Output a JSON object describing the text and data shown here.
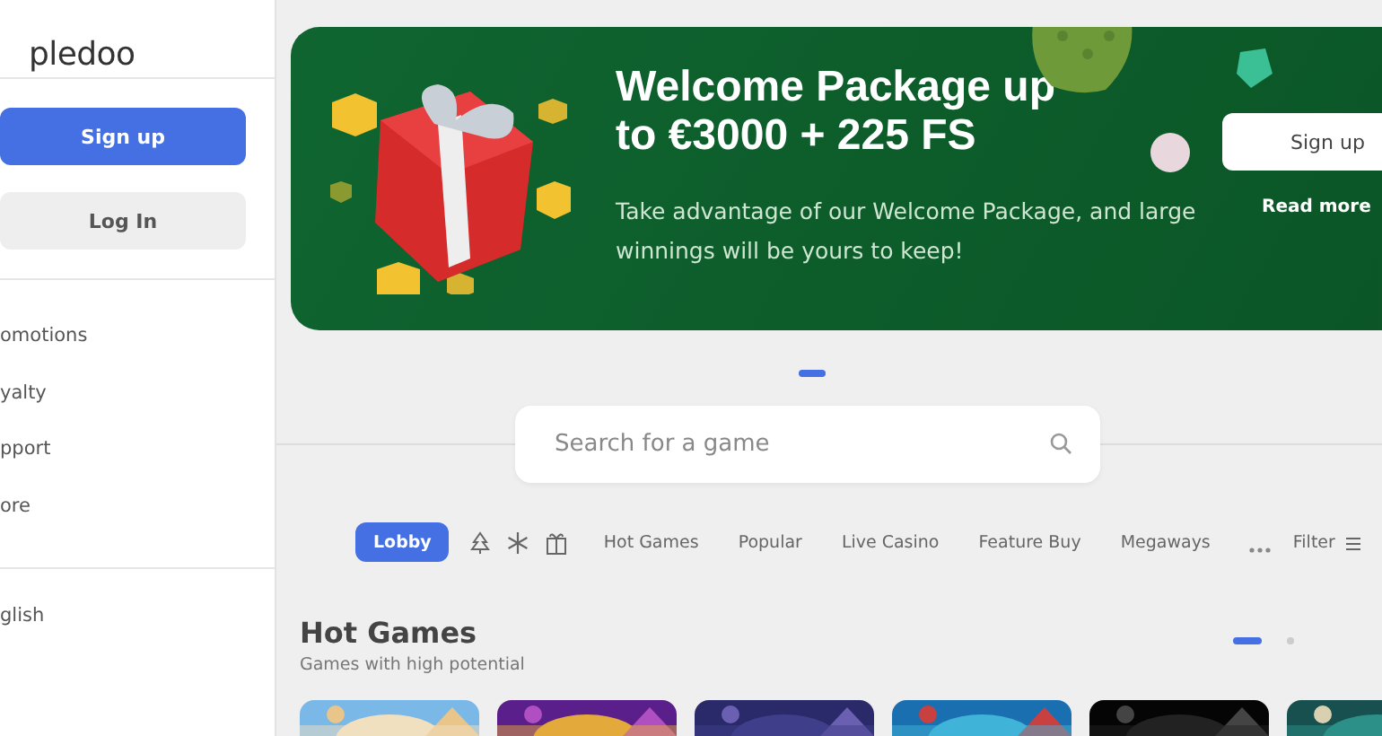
{
  "sidebar": {
    "logo": "pledoo",
    "buttons": [
      {
        "label": "Sign up",
        "kind": "primary"
      },
      {
        "label": "Log In",
        "kind": "secondary"
      }
    ],
    "menu": [
      "omotions",
      "yalty",
      "pport",
      "ore"
    ],
    "language": "glish"
  },
  "banner": {
    "title": "Welcome Package up to €3000 + 225 FS",
    "text": "Take advantage of our Welcome Package, and large winnings will be yours to keep!",
    "button": "Sign up",
    "link": "Read more"
  },
  "carousel_dots": [
    {
      "selected": true
    }
  ],
  "search": {
    "placeholder": "Search for a game"
  },
  "categories": [
    {
      "label": "Lobby",
      "selected": true
    },
    {
      "label": "Hot Games",
      "selected": false
    },
    {
      "label": "Popular",
      "selected": false
    },
    {
      "label": "Live Casino",
      "selected": false
    },
    {
      "label": "Feature Buy",
      "selected": false
    },
    {
      "label": "Megaways",
      "selected": false
    }
  ],
  "filter": "Filter",
  "section": {
    "title": "Hot Games",
    "subtitle": "Games with high potential",
    "pages": [
      {
        "selected": true
      },
      {
        "selected": false
      }
    ]
  }
}
